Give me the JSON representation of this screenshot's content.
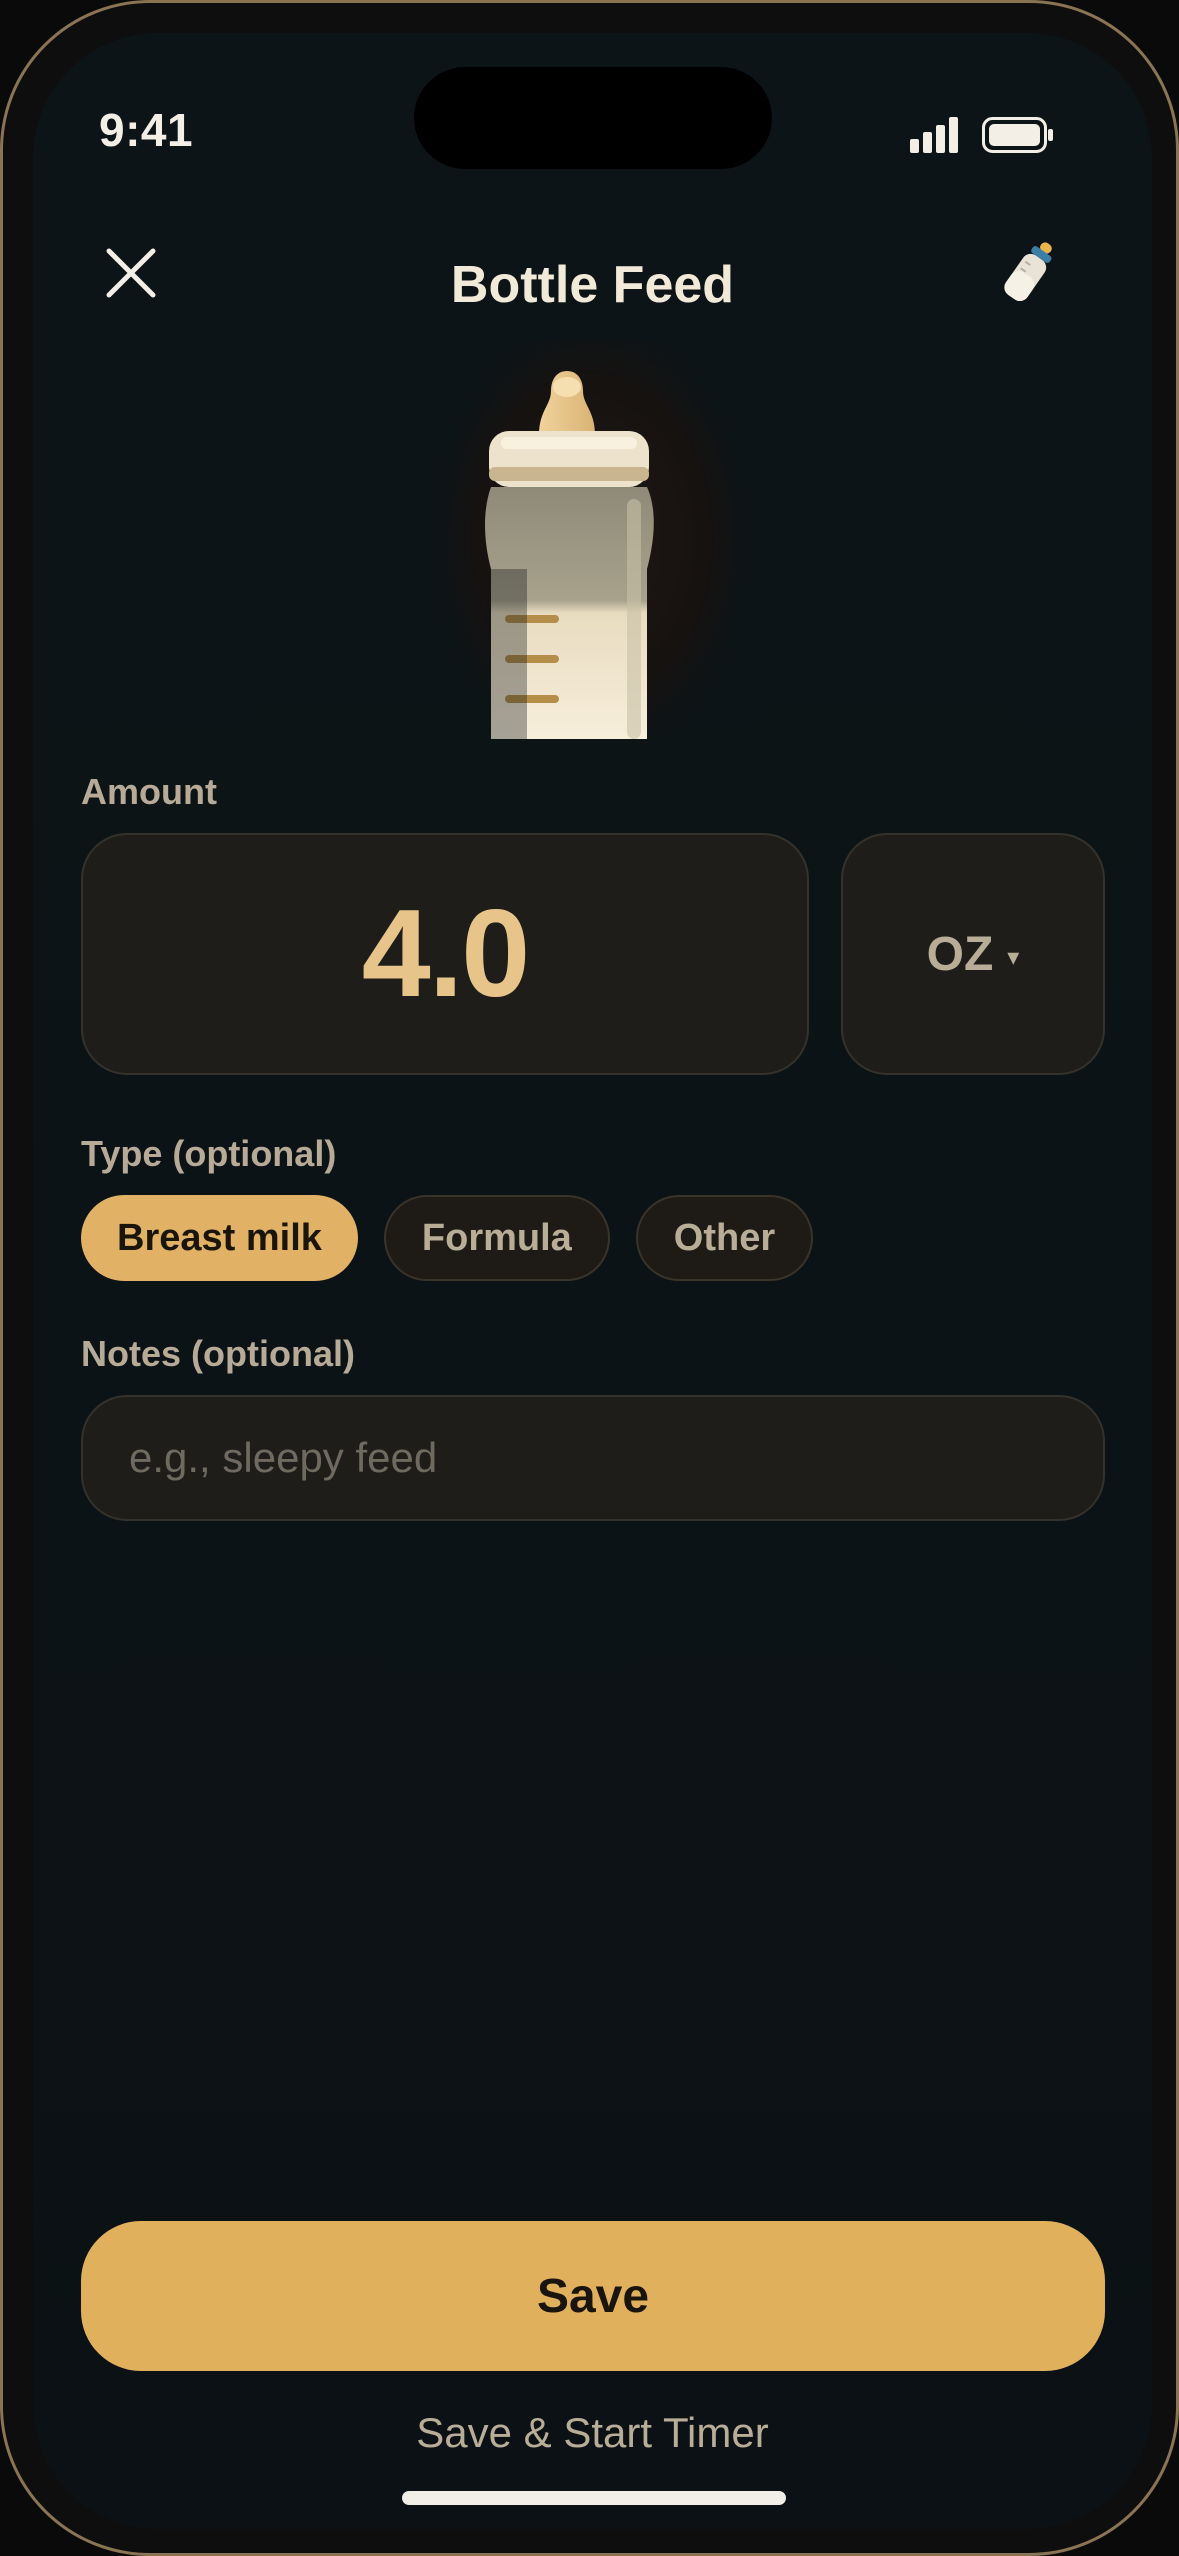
{
  "status_bar": {
    "time": "9:41"
  },
  "nav": {
    "title": "Bottle Feed",
    "close_icon": "close-icon",
    "bottle_icon": "baby-bottle-icon"
  },
  "amount": {
    "label": "Amount",
    "value": "4.0",
    "unit": "OZ",
    "unit_caret": "▾"
  },
  "type": {
    "label": "Type (optional)",
    "options": [
      {
        "label": "Breast milk",
        "selected": true
      },
      {
        "label": "Formula",
        "selected": false
      },
      {
        "label": "Other",
        "selected": false
      }
    ]
  },
  "notes": {
    "label": "Notes (optional)",
    "value": "",
    "placeholder": "e.g., sleepy feed"
  },
  "actions": {
    "save_label": "Save",
    "save_timer_label": "Save & Start Timer"
  },
  "colors": {
    "accent": "#e1b05c",
    "amount_text": "#e7c58a",
    "background": "#0d1417",
    "field_background": "#1e1d19"
  }
}
